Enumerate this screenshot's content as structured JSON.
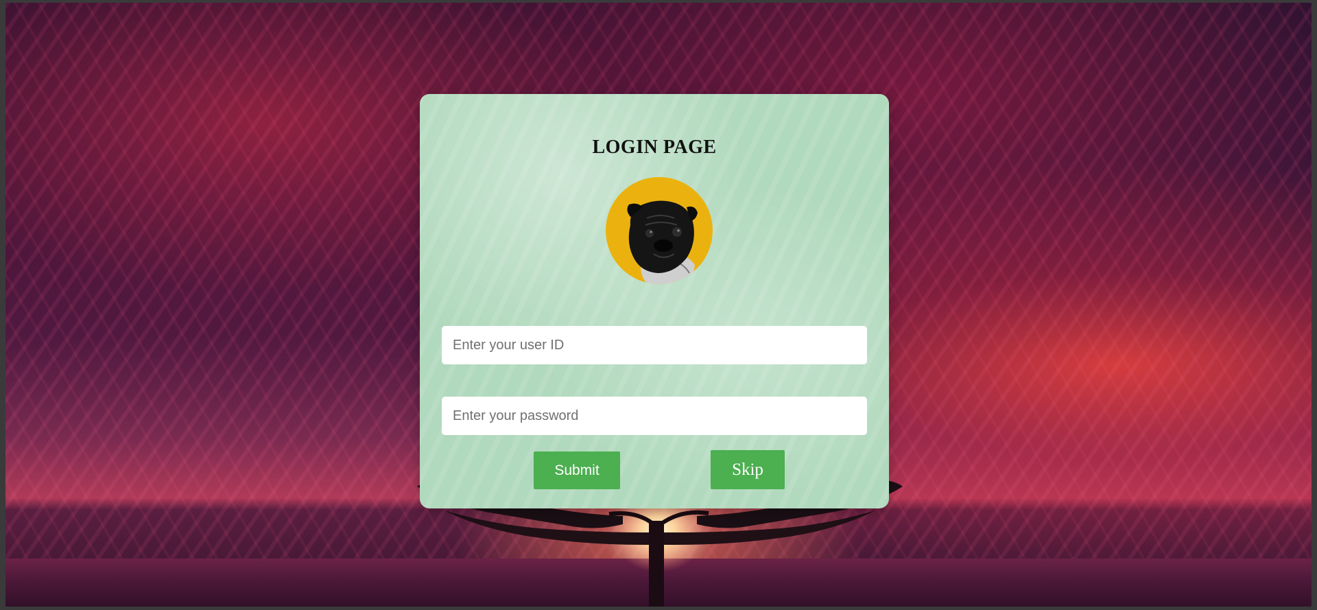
{
  "login": {
    "title": "LOGIN PAGE",
    "user_id_placeholder": "Enter your user ID",
    "user_id_value": "",
    "password_placeholder": "Enter your password",
    "password_value": "",
    "submit_label": "Submit",
    "skip_label": "Skip"
  },
  "avatar": {
    "icon": "pug-dog-avatar",
    "background_color": "#ebb20f"
  },
  "colors": {
    "card_background": "#b1d9bd",
    "button_background": "#4caf50",
    "button_text": "#ffffff"
  },
  "background": {
    "icon": "sunset-tree-sea-image"
  }
}
